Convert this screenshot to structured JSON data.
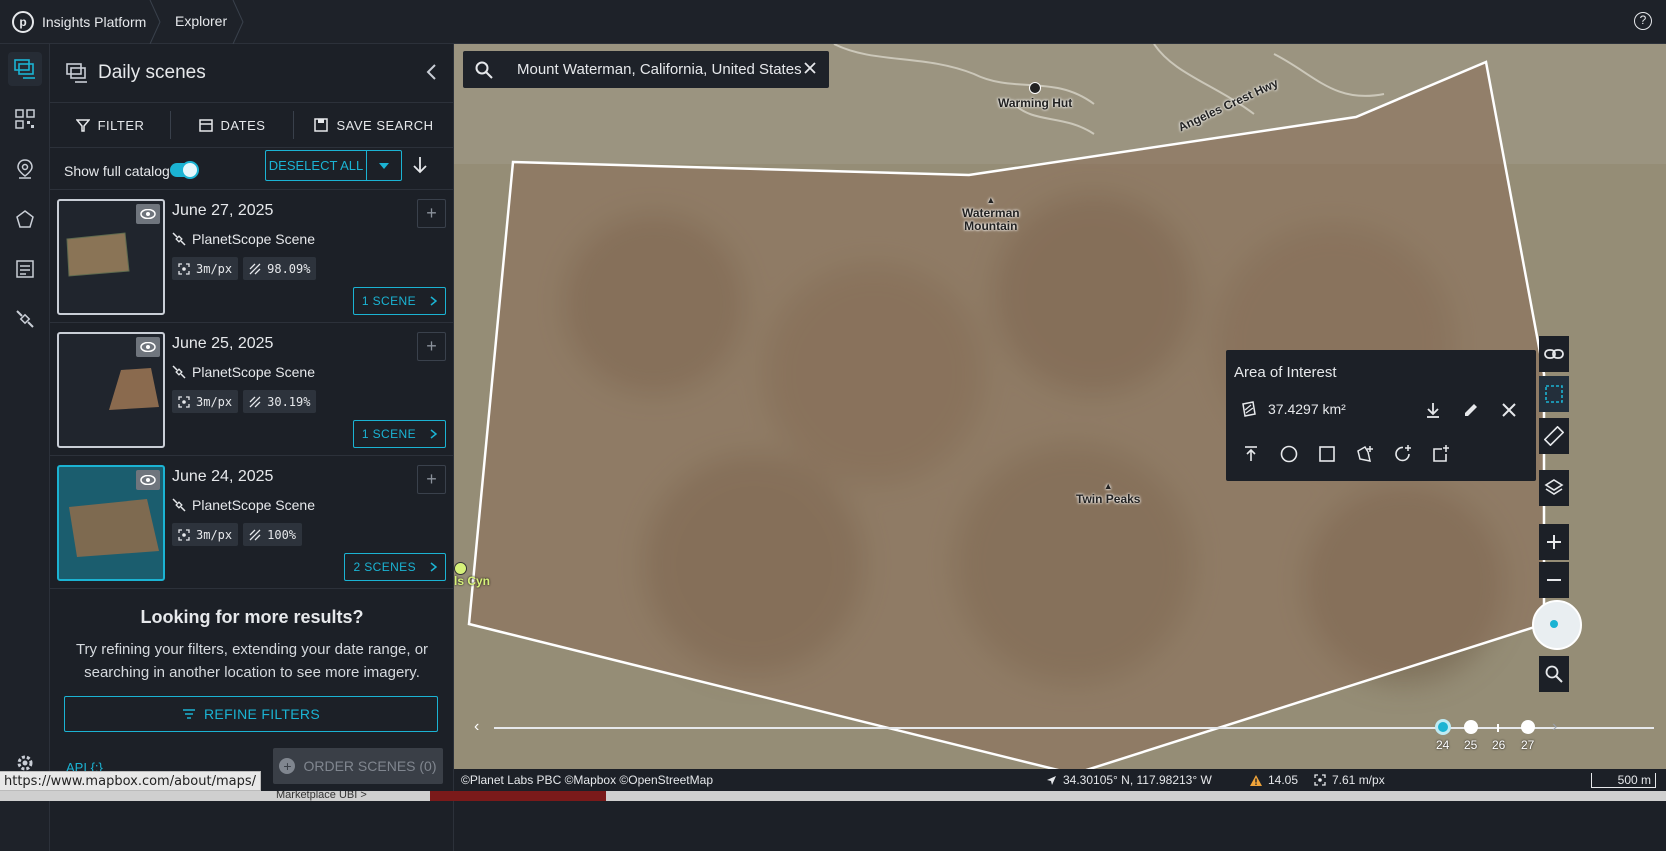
{
  "topbar": {
    "brand": "Insights Platform",
    "breadcrumb": "Explorer",
    "help_glyph": "?"
  },
  "rail": {
    "items": [
      "scenes-icon",
      "grid-icon",
      "pin-icon",
      "polygon-icon",
      "catalog-icon",
      "satellite-icon",
      "settings-icon"
    ]
  },
  "panel": {
    "title": "Daily scenes",
    "toolbar": {
      "filter_label": "FILTER",
      "dates_label": "DATES",
      "save_search_label": "SAVE SEARCH"
    },
    "catalog_toggle_label": "Show full catalog",
    "catalog_toggle_on": true,
    "deselect_all_label": "DESELECT ALL",
    "cards": [
      {
        "date": "June 27, 2025",
        "type": "PlanetScope Scene",
        "resolution": "3m/px",
        "coverage": "98.09%",
        "scenes_label": "1 SCENE",
        "selected": false
      },
      {
        "date": "June 25, 2025",
        "type": "PlanetScope Scene",
        "resolution": "3m/px",
        "coverage": "30.19%",
        "scenes_label": "1 SCENE",
        "selected": false
      },
      {
        "date": "June 24, 2025",
        "type": "PlanetScope Scene",
        "resolution": "3m/px",
        "coverage": "100%",
        "scenes_label": "2 SCENES",
        "selected": true
      }
    ],
    "more": {
      "heading": "Looking for more results?",
      "text": "Try refining your filters, extending your date range, or searching in another location to see more imagery.",
      "refine_label": "REFINE FILTERS"
    },
    "api_label": "API {:}",
    "order_label": "ORDER SCENES (0)"
  },
  "status_url": "https://www.mapbox.com/about/maps/",
  "bottom_tabs": [
    "Marketplace UBI >"
  ],
  "map": {
    "search_value": "Mount Waterman, California, United States",
    "labels": {
      "warming_hut": "Warming Hut",
      "angeles_crest": "Angeles Crest Hwy",
      "waterman_line1": "Waterman",
      "waterman_line2": "Mountain",
      "twin_peaks": "Twin Peaks",
      "canyon": "ls Cyn"
    },
    "aoi": {
      "title": "Area of Interest",
      "area": "37.4297 km²"
    },
    "timeline": {
      "days": [
        "24",
        "25",
        "26",
        "27"
      ],
      "current": "24"
    },
    "footer": {
      "attribution": "©Planet Labs PBC ©Mapbox ©OpenStreetMap",
      "coords": "34.30105° N, 117.98213° W",
      "warning_value": "14.05",
      "resolution": "7.61 m/px",
      "scale": "500 m"
    },
    "colors": {
      "accent": "#1bb3d3",
      "panel_bg": "#1c2027"
    }
  }
}
